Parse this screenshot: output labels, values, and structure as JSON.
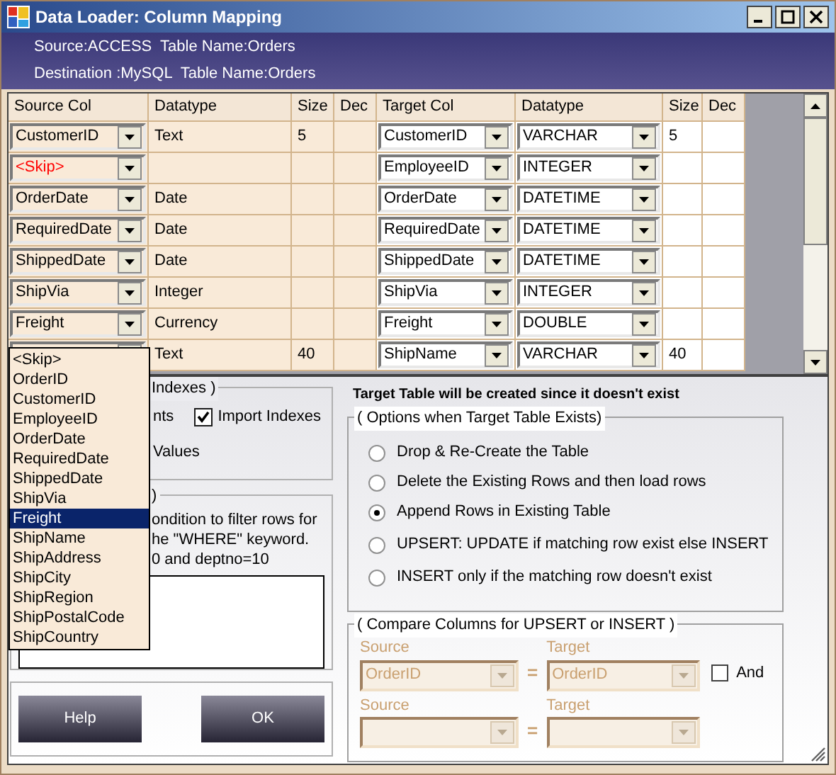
{
  "window": {
    "title": "Data Loader: Column Mapping"
  },
  "header": {
    "source": "Source:ACCESS  Table Name:Orders",
    "destination": "Destination :MySQL  Table Name:Orders"
  },
  "grid": {
    "columns": [
      {
        "label": "Source Col",
        "kind": "combo"
      },
      {
        "label": "Datatype",
        "kind": "text"
      },
      {
        "label": "Size",
        "kind": "text"
      },
      {
        "label": "Dec",
        "kind": "text"
      },
      {
        "label": "Target Col",
        "kind": "combo"
      },
      {
        "label": "Datatype",
        "kind": "combo"
      },
      {
        "label": "Size",
        "kind": "text"
      },
      {
        "label": "Dec",
        "kind": "text"
      }
    ],
    "rows": [
      {
        "skipped": false,
        "source_col": "CustomerID",
        "source_type": "Text",
        "source_size": "5",
        "target_col": "CustomerID",
        "target_type": "VARCHAR",
        "target_size": "5"
      },
      {
        "skipped": true,
        "source_col": "<Skip>",
        "target_col": "EmployeeID",
        "target_type": "INTEGER"
      },
      {
        "skipped": false,
        "source_col": "OrderDate",
        "source_type": "Date",
        "target_col": "OrderDate",
        "target_type": "DATETIME"
      },
      {
        "skipped": false,
        "source_col": "RequiredDate",
        "source_type": "Date",
        "target_col": "RequiredDate",
        "target_type": "DATETIME"
      },
      {
        "skipped": false,
        "source_col": "ShippedDate",
        "source_type": "Date",
        "target_col": "ShippedDate",
        "target_type": "DATETIME"
      },
      {
        "skipped": false,
        "source_col": "ShipVia",
        "source_type": "Integer",
        "target_col": "ShipVia",
        "target_type": "INTEGER"
      },
      {
        "skipped": false,
        "source_col": "Freight",
        "source_type": "Currency",
        "target_col": "Freight",
        "target_type": "DOUBLE"
      },
      {
        "source_type": "Text",
        "source_size": "40",
        "target_col": "ShipName",
        "target_type": "VARCHAR",
        "target_size": "40"
      }
    ]
  },
  "dropdown": {
    "items": [
      {
        "label": "<Skip>",
        "selected": false
      },
      {
        "label": "OrderID",
        "selected": false
      },
      {
        "label": "CustomerID",
        "selected": false
      },
      {
        "label": "EmployeeID",
        "selected": false
      },
      {
        "label": "OrderDate",
        "selected": false
      },
      {
        "label": "RequiredDate",
        "selected": false
      },
      {
        "label": "ShippedDate",
        "selected": false
      },
      {
        "label": "ShipVia",
        "selected": false
      },
      {
        "label": "Freight",
        "selected": true
      },
      {
        "label": "ShipName",
        "selected": false
      },
      {
        "label": "ShipAddress",
        "selected": false
      },
      {
        "label": "ShipCity",
        "selected": false
      },
      {
        "label": "ShipRegion",
        "selected": false
      },
      {
        "label": "ShipPostalCode",
        "selected": false
      },
      {
        "label": "ShipCountry",
        "selected": false
      }
    ]
  },
  "indexes_group": {
    "legend": "Indexes )",
    "first_option": "nts",
    "import_indexes": {
      "label": "Import Indexes",
      "checked": true
    },
    "third_option": "Values"
  },
  "filter_group": {
    "legend": ")",
    "lines": [
      "ondition to filter rows for",
      "he \"WHERE\" keyword.",
      "0 and deptno=10"
    ]
  },
  "buttons": [
    "Help",
    "OK"
  ],
  "notice": "Target Table will be created since it doesn't exist",
  "options_group": {
    "legend": "( Options when Target Table Exists)",
    "options": [
      {
        "label": "Drop & Re-Create the Table",
        "selected": false
      },
      {
        "label": "Delete the Existing Rows and then load rows",
        "selected": false
      },
      {
        "label": "Append Rows in Existing Table",
        "selected": true
      },
      {
        "label": "UPSERT: UPDATE if matching row exist else INSERT",
        "selected": false
      },
      {
        "label": "INSERT only if the matching row doesn't exist",
        "selected": false
      }
    ]
  },
  "compare_group": {
    "legend": "( Compare Columns for UPSERT or INSERT )",
    "rows": [
      {
        "source_label": "Source",
        "source_value": "OrderID",
        "equals": "=",
        "target_label": "Target",
        "target_value": "OrderID",
        "disabled": true
      },
      {
        "source_label": "Source",
        "equals": "=",
        "target_label": "Target",
        "disabled": true
      }
    ],
    "and_checkbox": {
      "label": "And",
      "checked": false
    }
  }
}
